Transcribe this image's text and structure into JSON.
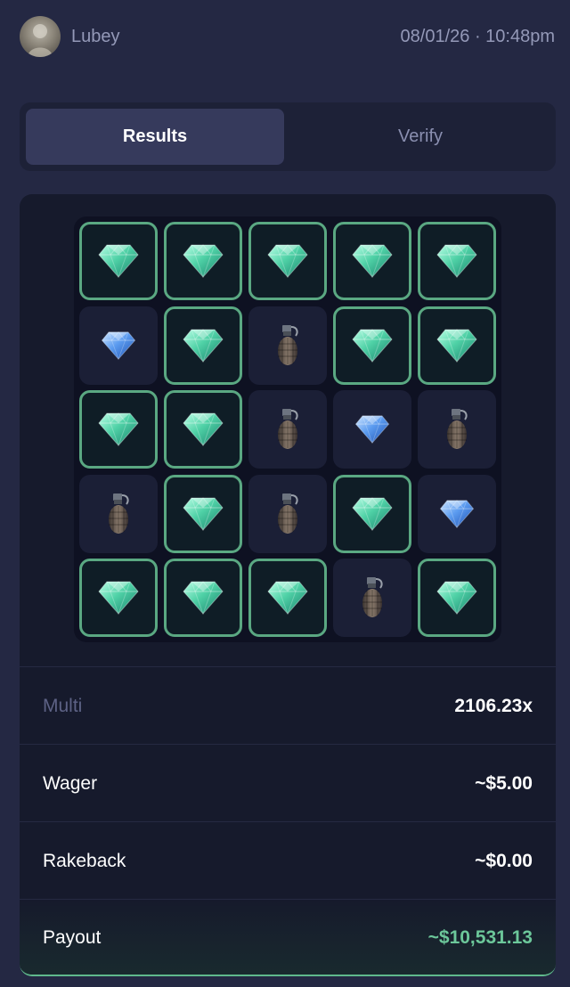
{
  "header": {
    "username": "Lubey",
    "datetime": "08/01/26 · 10:48pm"
  },
  "tabs": [
    {
      "label": "Results",
      "active": true
    },
    {
      "label": "Verify",
      "active": false
    }
  ],
  "board": {
    "rows": 5,
    "cols": 5,
    "cells": [
      [
        "gem-picked",
        "gem-picked",
        "gem-picked",
        "gem-picked",
        "gem-picked"
      ],
      [
        "gem",
        "gem-picked",
        "bomb",
        "gem-picked",
        "gem-picked"
      ],
      [
        "gem-picked",
        "gem-picked",
        "bomb",
        "gem",
        "bomb"
      ],
      [
        "bomb",
        "gem-picked",
        "bomb",
        "gem-picked",
        "gem"
      ],
      [
        "gem-picked",
        "gem-picked",
        "gem-picked",
        "bomb",
        "gem-picked"
      ]
    ]
  },
  "stats": {
    "multi_label": "Multi",
    "multi_value": "2106.23x",
    "wager_label": "Wager",
    "wager_value": "~$5.00",
    "rakeback_label": "Rakeback",
    "rakeback_value": "~$0.00",
    "payout_label": "Payout",
    "payout_value": "~$10,531.13"
  },
  "colors": {
    "background": "#242843",
    "card": "#161a2c",
    "accent_green": "#6cc79a",
    "picked_border": "#5aa882"
  }
}
